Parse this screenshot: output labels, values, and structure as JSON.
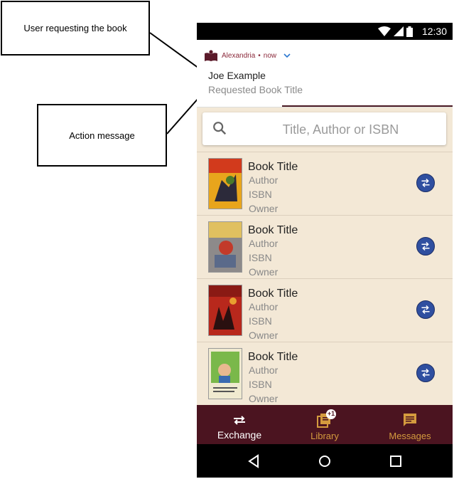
{
  "callouts": {
    "user": "User requesting the book",
    "action": "Action message"
  },
  "status_bar": {
    "time": "12:30"
  },
  "notification": {
    "app_name": "Alexandria",
    "when": "now",
    "separator": "•",
    "title": "Joe Example",
    "text": "Requested Book Title"
  },
  "search": {
    "placeholder": "Title, Author or ISBN",
    "value": ""
  },
  "books": [
    {
      "title": "Book Title",
      "author": "Author",
      "isbn": "ISBN",
      "owner": "Owner"
    },
    {
      "title": "Book Title",
      "author": "Author",
      "isbn": "ISBN",
      "owner": "Owner"
    },
    {
      "title": "Book Title",
      "author": "Author",
      "isbn": "ISBN",
      "owner": "Owner"
    },
    {
      "title": "Book Title",
      "author": "Author",
      "isbn": "ISBN",
      "owner": "Owner"
    }
  ],
  "bottom_nav": {
    "exchange": "Exchange",
    "library": "Library",
    "library_badge": "+1",
    "messages": "Messages"
  },
  "colors": {
    "accent": "#4b1420",
    "nav_inactive": "#d49b3e",
    "background": "#f3e8d6",
    "action_blue": "#2f4fa0"
  },
  "icons": {
    "search": "search-icon",
    "exchange": "exchange-icon",
    "library": "library-icon",
    "messages": "messages-icon"
  }
}
